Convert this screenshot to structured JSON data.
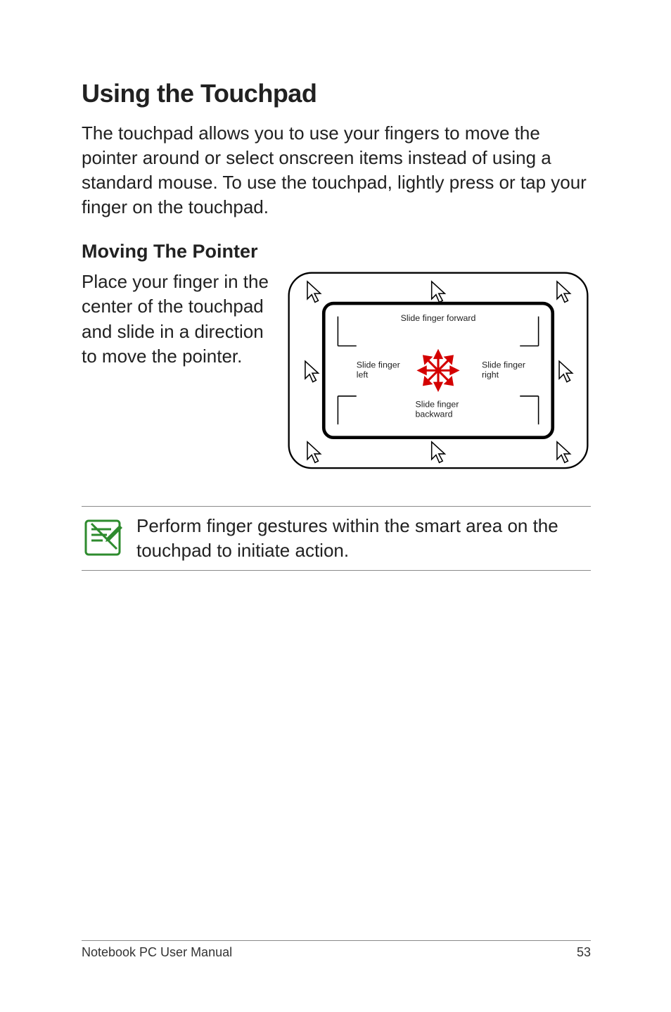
{
  "title": "Using the Touchpad",
  "intro": "The touchpad allows you to use your fingers to move the pointer around or select onscreen items instead of using a standard mouse. To use the touchpad, lightly press or tap your finger on the touchpad.",
  "subheading": "Moving The Pointer",
  "side_text": "Place your finger in the center of the touchpad and slide in a direction to move the pointer.",
  "diagram": {
    "label_forward": "Slide finger forward",
    "label_left": "Slide finger left",
    "label_right": "Slide finger right",
    "label_backward": "Slide finger backward"
  },
  "note": "Perform finger gestures within the smart area on the touchpad to initiate action.",
  "footer_left": "Notebook PC User Manual",
  "footer_right": "53"
}
